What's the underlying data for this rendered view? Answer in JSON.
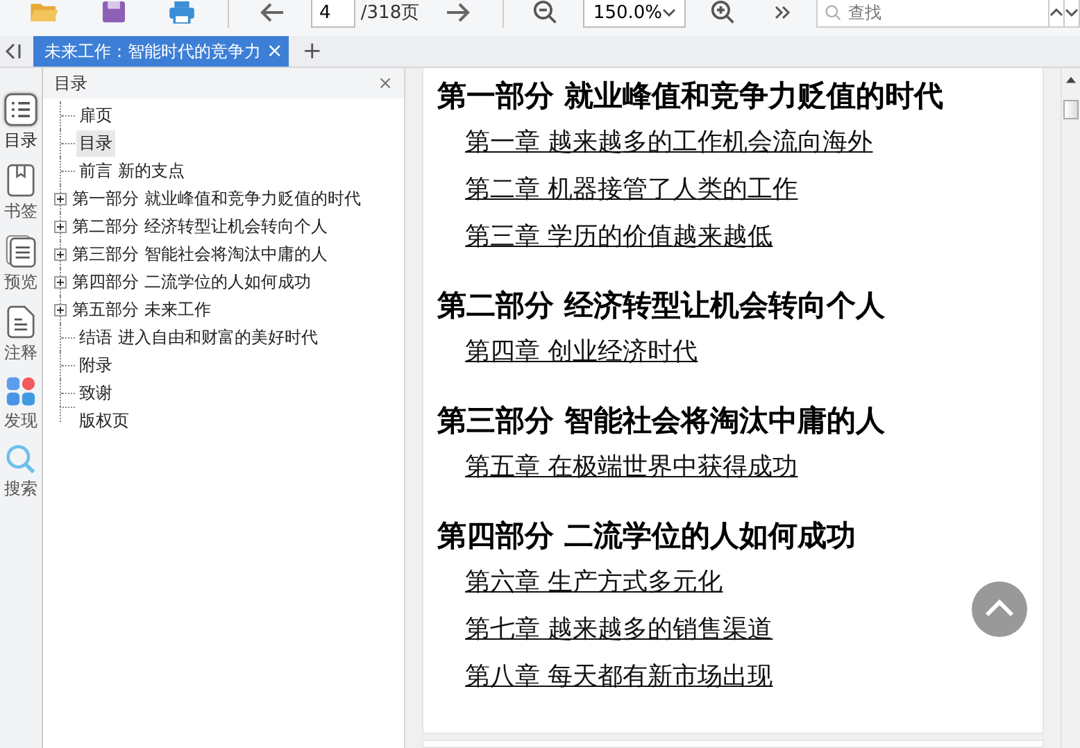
{
  "toolbar": {
    "page_input": "4",
    "page_total": "/318页",
    "zoom": "150.0%",
    "search": {
      "placeholder": "查找"
    }
  },
  "tabs": [
    {
      "label": "未来工作：智能时代的竞争力",
      "selected": true
    }
  ],
  "tab_close": "×",
  "tab_add": "+",
  "rail": [
    {
      "kind": "list",
      "label": "目录",
      "selected": true
    },
    {
      "kind": "bookmark",
      "label": "书签",
      "selected": false
    },
    {
      "kind": "preview",
      "label": "预览",
      "selected": false
    },
    {
      "kind": "note",
      "label": "注释",
      "selected": false
    },
    {
      "kind": "discover",
      "label": "发现",
      "selected": false
    },
    {
      "kind": "search",
      "label": "搜索",
      "selected": false
    }
  ],
  "toc": {
    "title": "目录",
    "close": "×",
    "items": [
      {
        "label": "扉页",
        "selected": false
      },
      {
        "label": "目录",
        "selected": true
      },
      {
        "label": "前言 新的支点",
        "selected": false
      },
      {
        "label": "第一部分 就业峰值和竞争力贬值的时代",
        "selected": false,
        "expanded": false
      },
      {
        "label": "第二部分 经济转型让机会转向个人",
        "selected": false,
        "expanded": false
      },
      {
        "label": "第三部分 智能社会将淘汰中庸的人",
        "selected": false,
        "expanded": false
      },
      {
        "label": "第四部分 二流学位的人如何成功",
        "selected": false,
        "expanded": false
      },
      {
        "label": "第五部分 未来工作",
        "selected": false,
        "expanded": false
      },
      {
        "label": "结语 进入自由和财富的美好时代",
        "selected": false
      },
      {
        "label": "附录",
        "selected": false
      },
      {
        "label": "致谢",
        "selected": false
      },
      {
        "label": "版权页",
        "selected": false
      }
    ]
  },
  "page": {
    "sections": [
      {
        "heading": "第一部分 就业峰值和竞争力贬值的时代",
        "chapters": [
          "第一章 越来越多的工作机会流向海外",
          "第二章 机器接管了人类的工作",
          "第三章 学历的价值越来越低"
        ]
      },
      {
        "heading": "第二部分 经济转型让机会转向个人",
        "chapters": [
          "第四章 创业经济时代"
        ]
      },
      {
        "heading": "第三部分 智能社会将淘汰中庸的人",
        "chapters": [
          "第五章 在极端世界中获得成功"
        ]
      },
      {
        "heading": "第四部分 二流学位的人如何成功",
        "chapters": [
          "第六章 生产方式多元化",
          "第七章 越来越多的销售渠道",
          "第八章 每天都有新市场出现"
        ]
      }
    ]
  }
}
